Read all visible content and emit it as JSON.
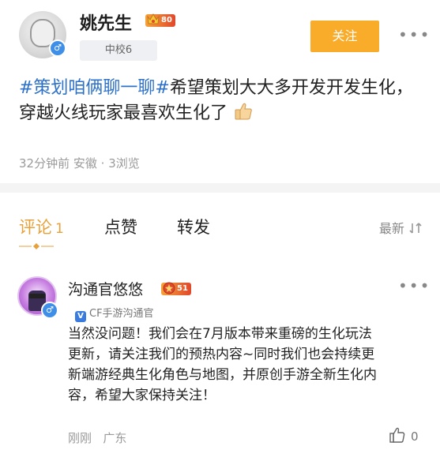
{
  "post": {
    "author": "姚先生",
    "level": "80",
    "school": "中校6",
    "gender_symbol": "♂",
    "follow_label": "关注",
    "more_label": "•••",
    "topic": "#策划咱俩聊一聊#",
    "text": "希望策划大大多开发开发生化，穿越火线玩家最喜欢生化了",
    "emoji": "thumbs-up-icon",
    "time": "32分钟前",
    "location": "安徽",
    "views": "3浏览"
  },
  "tabs": {
    "comments_label": "评论",
    "comments_count": "1",
    "likes_label": "点赞",
    "reposts_label": "转发",
    "sort_label": "最新"
  },
  "comment": {
    "author": "沟通官悠悠",
    "level": "51",
    "gender_symbol": "♂",
    "verify_mark": "V",
    "verify_label": "CF手游沟通官",
    "more_label": "•••",
    "text": "当然没问题！我们会在7月版本带来重磅的生化玩法更新，请关注我们的预热内容~同时我们也会持续更新端游经典生化角色与地图，并原创手游全新生化内容，希望大家保持关注！",
    "time": "刚刚",
    "location": "广东",
    "likes": "0"
  },
  "colors": {
    "accent": "#f9ac2a",
    "tab_active": "#e7a13b",
    "topic_blue": "#2d71c8",
    "gender_blue": "#3f8fe8"
  }
}
